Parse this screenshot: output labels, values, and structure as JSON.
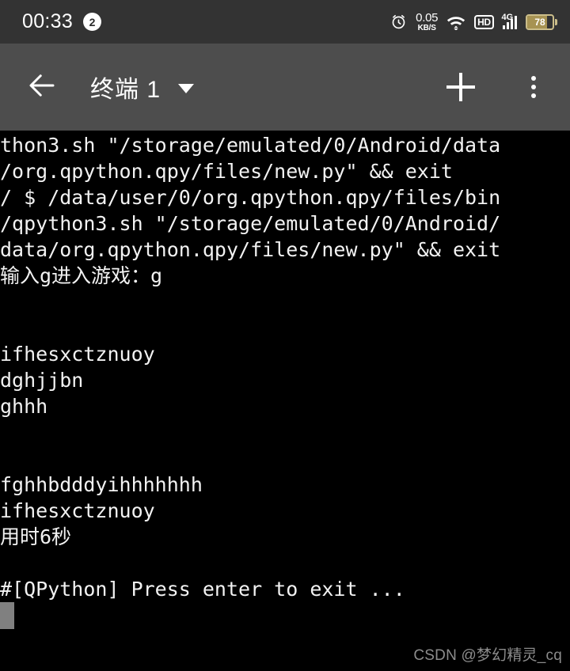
{
  "status_bar": {
    "clock": "00:33",
    "notification_count": "2",
    "alarm_icon": "alarm-clock-icon",
    "net_speed_value": "0.05",
    "net_speed_unit": "KB/S",
    "wifi_icon": "wifi-icon",
    "hd_label": "HD",
    "network_generation": "4G",
    "battery_level": "78",
    "battery_percent": 78,
    "background": "#333333"
  },
  "toolbar": {
    "back_icon": "back-arrow-icon",
    "title": "终端 1",
    "caret_icon": "chevron-down-icon",
    "add_icon": "plus-icon",
    "overflow_icon": "more-vertical-icon",
    "background": "#4d4d4d"
  },
  "terminal": {
    "background": "#000000",
    "foreground": "#f2f2f2",
    "cursor_color": "#808080",
    "lines": [
      "thon3.sh \"/storage/emulated/0/Android/data",
      "/org.qpython.qpy/files/new.py\" && exit",
      "/ $ /data/user/0/org.qpython.qpy/files/bin",
      "/qpython3.sh \"/storage/emulated/0/Android/",
      "data/org.qpython.qpy/files/new.py\" && exit",
      "输入g进入游戏：g",
      "",
      "",
      "ifhesxctznuoy",
      "dghjjbn",
      "ghhh",
      "",
      "",
      "fghhbdddyihhhhhhh",
      "ifhesxctznuoy",
      "用时6秒",
      "",
      "#[QPython] Press enter to exit ..."
    ]
  },
  "watermark": {
    "text": "CSDN @梦幻精灵_cq"
  }
}
